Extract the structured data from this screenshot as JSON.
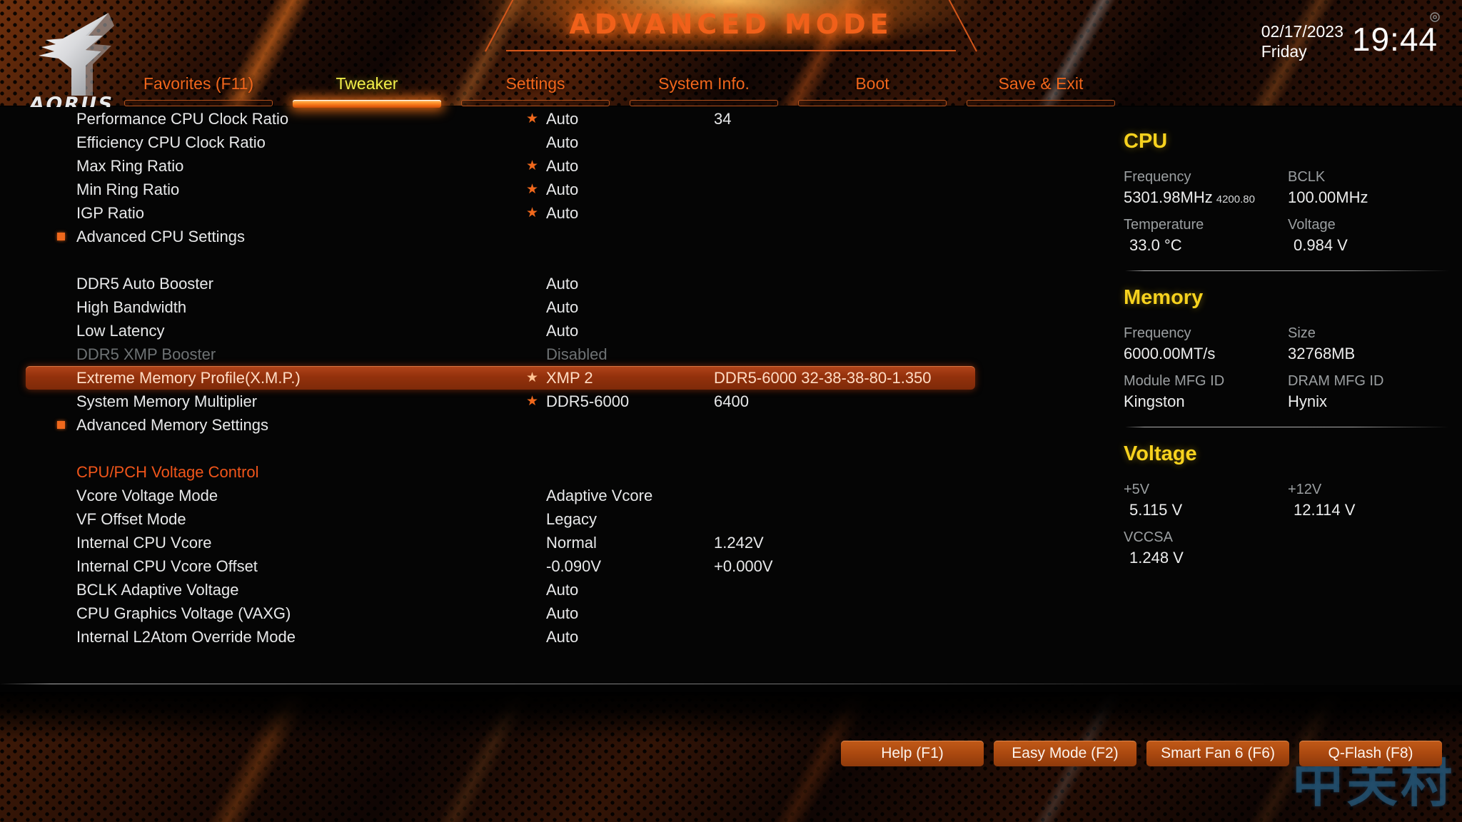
{
  "header": {
    "mode_title": "ADVANCED MODE",
    "logo_word": "AORUS",
    "date": "02/17/2023",
    "day": "Friday",
    "time": "19:44"
  },
  "nav": {
    "items": [
      {
        "label": "Favorites (F11)",
        "active": false
      },
      {
        "label": "Tweaker",
        "active": true
      },
      {
        "label": "Settings",
        "active": false
      },
      {
        "label": "System Info.",
        "active": false
      },
      {
        "label": "Boot",
        "active": false
      },
      {
        "label": "Save & Exit",
        "active": false
      }
    ]
  },
  "settings": {
    "rows": [
      {
        "name": "Performance CPU Clock Ratio",
        "star": true,
        "value": "Auto",
        "value2": "34",
        "type": "item"
      },
      {
        "name": "Efficiency CPU Clock Ratio",
        "star": false,
        "value": "Auto",
        "value2": "",
        "type": "item"
      },
      {
        "name": "Max Ring Ratio",
        "star": true,
        "value": "Auto",
        "value2": "",
        "type": "item"
      },
      {
        "name": "Min Ring Ratio",
        "star": true,
        "value": "Auto",
        "value2": "",
        "type": "item"
      },
      {
        "name": "IGP Ratio",
        "star": true,
        "value": "Auto",
        "value2": "",
        "type": "item"
      },
      {
        "name": "Advanced CPU Settings",
        "star": false,
        "value": "",
        "value2": "",
        "type": "submenu"
      },
      {
        "name": "",
        "star": false,
        "value": "",
        "value2": "",
        "type": "spacer"
      },
      {
        "name": "DDR5 Auto Booster",
        "star": false,
        "value": "Auto",
        "value2": "",
        "type": "item"
      },
      {
        "name": "High Bandwidth",
        "star": false,
        "value": "Auto",
        "value2": "",
        "type": "item"
      },
      {
        "name": "Low Latency",
        "star": false,
        "value": "Auto",
        "value2": "",
        "type": "item"
      },
      {
        "name": "DDR5 XMP Booster",
        "star": false,
        "value": "Disabled",
        "value2": "",
        "type": "disabled"
      },
      {
        "name": "Extreme Memory Profile(X.M.P.)",
        "star": true,
        "value": "XMP 2",
        "value2": "DDR5-6000 32-38-38-80-1.350",
        "type": "selected"
      },
      {
        "name": "System Memory Multiplier",
        "star": true,
        "value": "DDR5-6000",
        "value2": "6400",
        "type": "item"
      },
      {
        "name": "Advanced Memory Settings",
        "star": false,
        "value": "",
        "value2": "",
        "type": "submenu"
      },
      {
        "name": "",
        "star": false,
        "value": "",
        "value2": "",
        "type": "spacer"
      },
      {
        "name": "CPU/PCH Voltage Control",
        "star": false,
        "value": "",
        "value2": "",
        "type": "section"
      },
      {
        "name": "Vcore Voltage Mode",
        "star": false,
        "value": "Adaptive Vcore",
        "value2": "",
        "type": "item"
      },
      {
        "name": "VF Offset Mode",
        "star": false,
        "value": "Legacy",
        "value2": "",
        "type": "item"
      },
      {
        "name": "Internal CPU Vcore",
        "star": false,
        "value": "Normal",
        "value2": "1.242V",
        "type": "item"
      },
      {
        "name": "Internal CPU Vcore Offset",
        "star": false,
        "value": "-0.090V",
        "value2": "+0.000V",
        "type": "item"
      },
      {
        "name": "BCLK Adaptive Voltage",
        "star": false,
        "value": "Auto",
        "value2": "",
        "type": "item"
      },
      {
        "name": "CPU Graphics Voltage (VAXG)",
        "star": false,
        "value": "Auto",
        "value2": "",
        "type": "item"
      },
      {
        "name": "Internal L2Atom Override Mode",
        "star": false,
        "value": "Auto",
        "value2": "",
        "type": "item"
      }
    ],
    "star_glyph": "★",
    "selected_index": 11
  },
  "info_panel": {
    "sections": [
      {
        "title": "CPU",
        "fields": [
          {
            "key": "Frequency",
            "value": "5301.98MHz",
            "sub": "4200.80"
          },
          {
            "key": "BCLK",
            "value": "100.00MHz",
            "sub": ""
          },
          {
            "key": "Temperature",
            "value": "33.0 °C",
            "sub": "",
            "indent": true
          },
          {
            "key": "Voltage",
            "value": "0.984 V",
            "sub": "",
            "indent": true
          }
        ]
      },
      {
        "title": "Memory",
        "fields": [
          {
            "key": "Frequency",
            "value": "6000.00MT/s",
            "sub": ""
          },
          {
            "key": "Size",
            "value": "32768MB",
            "sub": ""
          },
          {
            "key": "Module MFG ID",
            "value": "Kingston",
            "sub": ""
          },
          {
            "key": "DRAM MFG ID",
            "value": "Hynix",
            "sub": ""
          }
        ]
      },
      {
        "title": "Voltage",
        "fields": [
          {
            "key": "+5V",
            "value": "5.115 V",
            "sub": "",
            "indent": true
          },
          {
            "key": "+12V",
            "value": "12.114 V",
            "sub": "",
            "indent": true
          },
          {
            "key": "VCCSA",
            "value": "1.248 V",
            "sub": "",
            "indent": true
          },
          {
            "key": "",
            "value": "",
            "sub": ""
          }
        ]
      }
    ]
  },
  "footer": {
    "fkeys": [
      {
        "label": "Help (F1)"
      },
      {
        "label": "Easy Mode (F2)"
      },
      {
        "label": "Smart Fan 6 (F6)"
      },
      {
        "label": "Q-Flash (F8)"
      }
    ],
    "watermark": "中关村"
  },
  "colors": {
    "accent_orange": "#f0661c",
    "active_yellow": "#f2ef4a",
    "panel_yellow": "#f7d21e",
    "selected_row": "#a8400f",
    "text": "#e8e9ea",
    "dim_text": "#6e7274"
  }
}
